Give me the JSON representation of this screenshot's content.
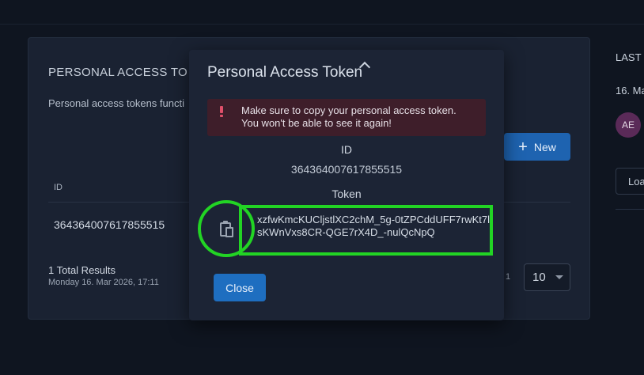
{
  "card": {
    "title": "PERSONAL ACCESS TO",
    "description": "Personal access tokens functi",
    "new_button": "New",
    "columns": {
      "id": "ID"
    },
    "rows": [
      {
        "id": "364364007617855515"
      }
    ],
    "footer": {
      "total": "1 Total Results",
      "date": "Monday 16. Mar 2026, 17:11",
      "page": "1",
      "page_size": "10"
    }
  },
  "side": {
    "heading": "LAST",
    "date": "16. Ma",
    "avatar_initials": "AE",
    "button": "Loa"
  },
  "modal": {
    "title": "Personal Access Token",
    "alert_line1": "Make sure to copy your personal access token.",
    "alert_line2": "You won't be able to see it again!",
    "id_label": "ID",
    "id_value": "364364007617855515",
    "token_label": "Token",
    "token_value": "xzfwKmcKUCljstlXC2chM_5g-0tZPCddUFF7rwKt7lsKWnVxs8CR-QGE7rX4D_-nulQcNpQ",
    "close_button": "Close"
  },
  "colors": {
    "background": "#0f1520",
    "card": "#1a2232",
    "modal": "#1c2435",
    "primary": "#1e6ec0",
    "alert_bg": "#3e1e2a",
    "alert_icon": "#e0506a",
    "highlight": "#22d424",
    "avatar": "#5a2a58"
  },
  "icons": {
    "copy": "clipboard-icon",
    "collapse": "chevron-up-icon",
    "alert": "exclamation-icon",
    "add": "plus-icon",
    "select": "caret-down-icon"
  }
}
